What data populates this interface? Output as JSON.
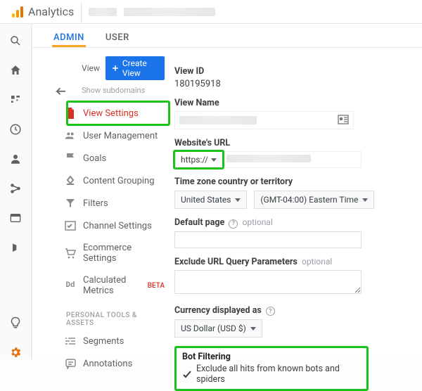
{
  "header": {
    "product": "Analytics"
  },
  "tabs": {
    "admin": "ADMIN",
    "user": "USER"
  },
  "left": {
    "viewLabel": "View",
    "createView": "Create View",
    "showSubdomains": "Show subdomains",
    "items": {
      "viewSettings": "View Settings",
      "userMgmt": "User Management",
      "goals": "Goals",
      "contentGrouping": "Content Grouping",
      "filters": "Filters",
      "channelSettings": "Channel Settings",
      "ecommerce": "Ecommerce Settings",
      "calcMetrics": "Calculated Metrics",
      "calcBeta": "BETA"
    },
    "section2": "PERSONAL TOOLS & ASSETS",
    "items2": {
      "segments": "Segments",
      "annotations": "Annotations"
    }
  },
  "form": {
    "viewIdLabel": "View ID",
    "viewId": "180195918",
    "viewNameLabel": "View Name",
    "urlLabel": "Website's URL",
    "protocol": "https://",
    "tzLabel": "Time zone country or territory",
    "tzCountry": "United States",
    "tz": "(GMT-04:00) Eastern Time",
    "defaultPageLabel": "Default page",
    "optional": "optional",
    "excludeLabel": "Exclude URL Query Parameters",
    "currencyLabel": "Currency displayed as",
    "currency": "US Dollar (USD $)",
    "botTitle": "Bot Filtering",
    "botCheck": "Exclude all hits from known bots and spiders"
  }
}
